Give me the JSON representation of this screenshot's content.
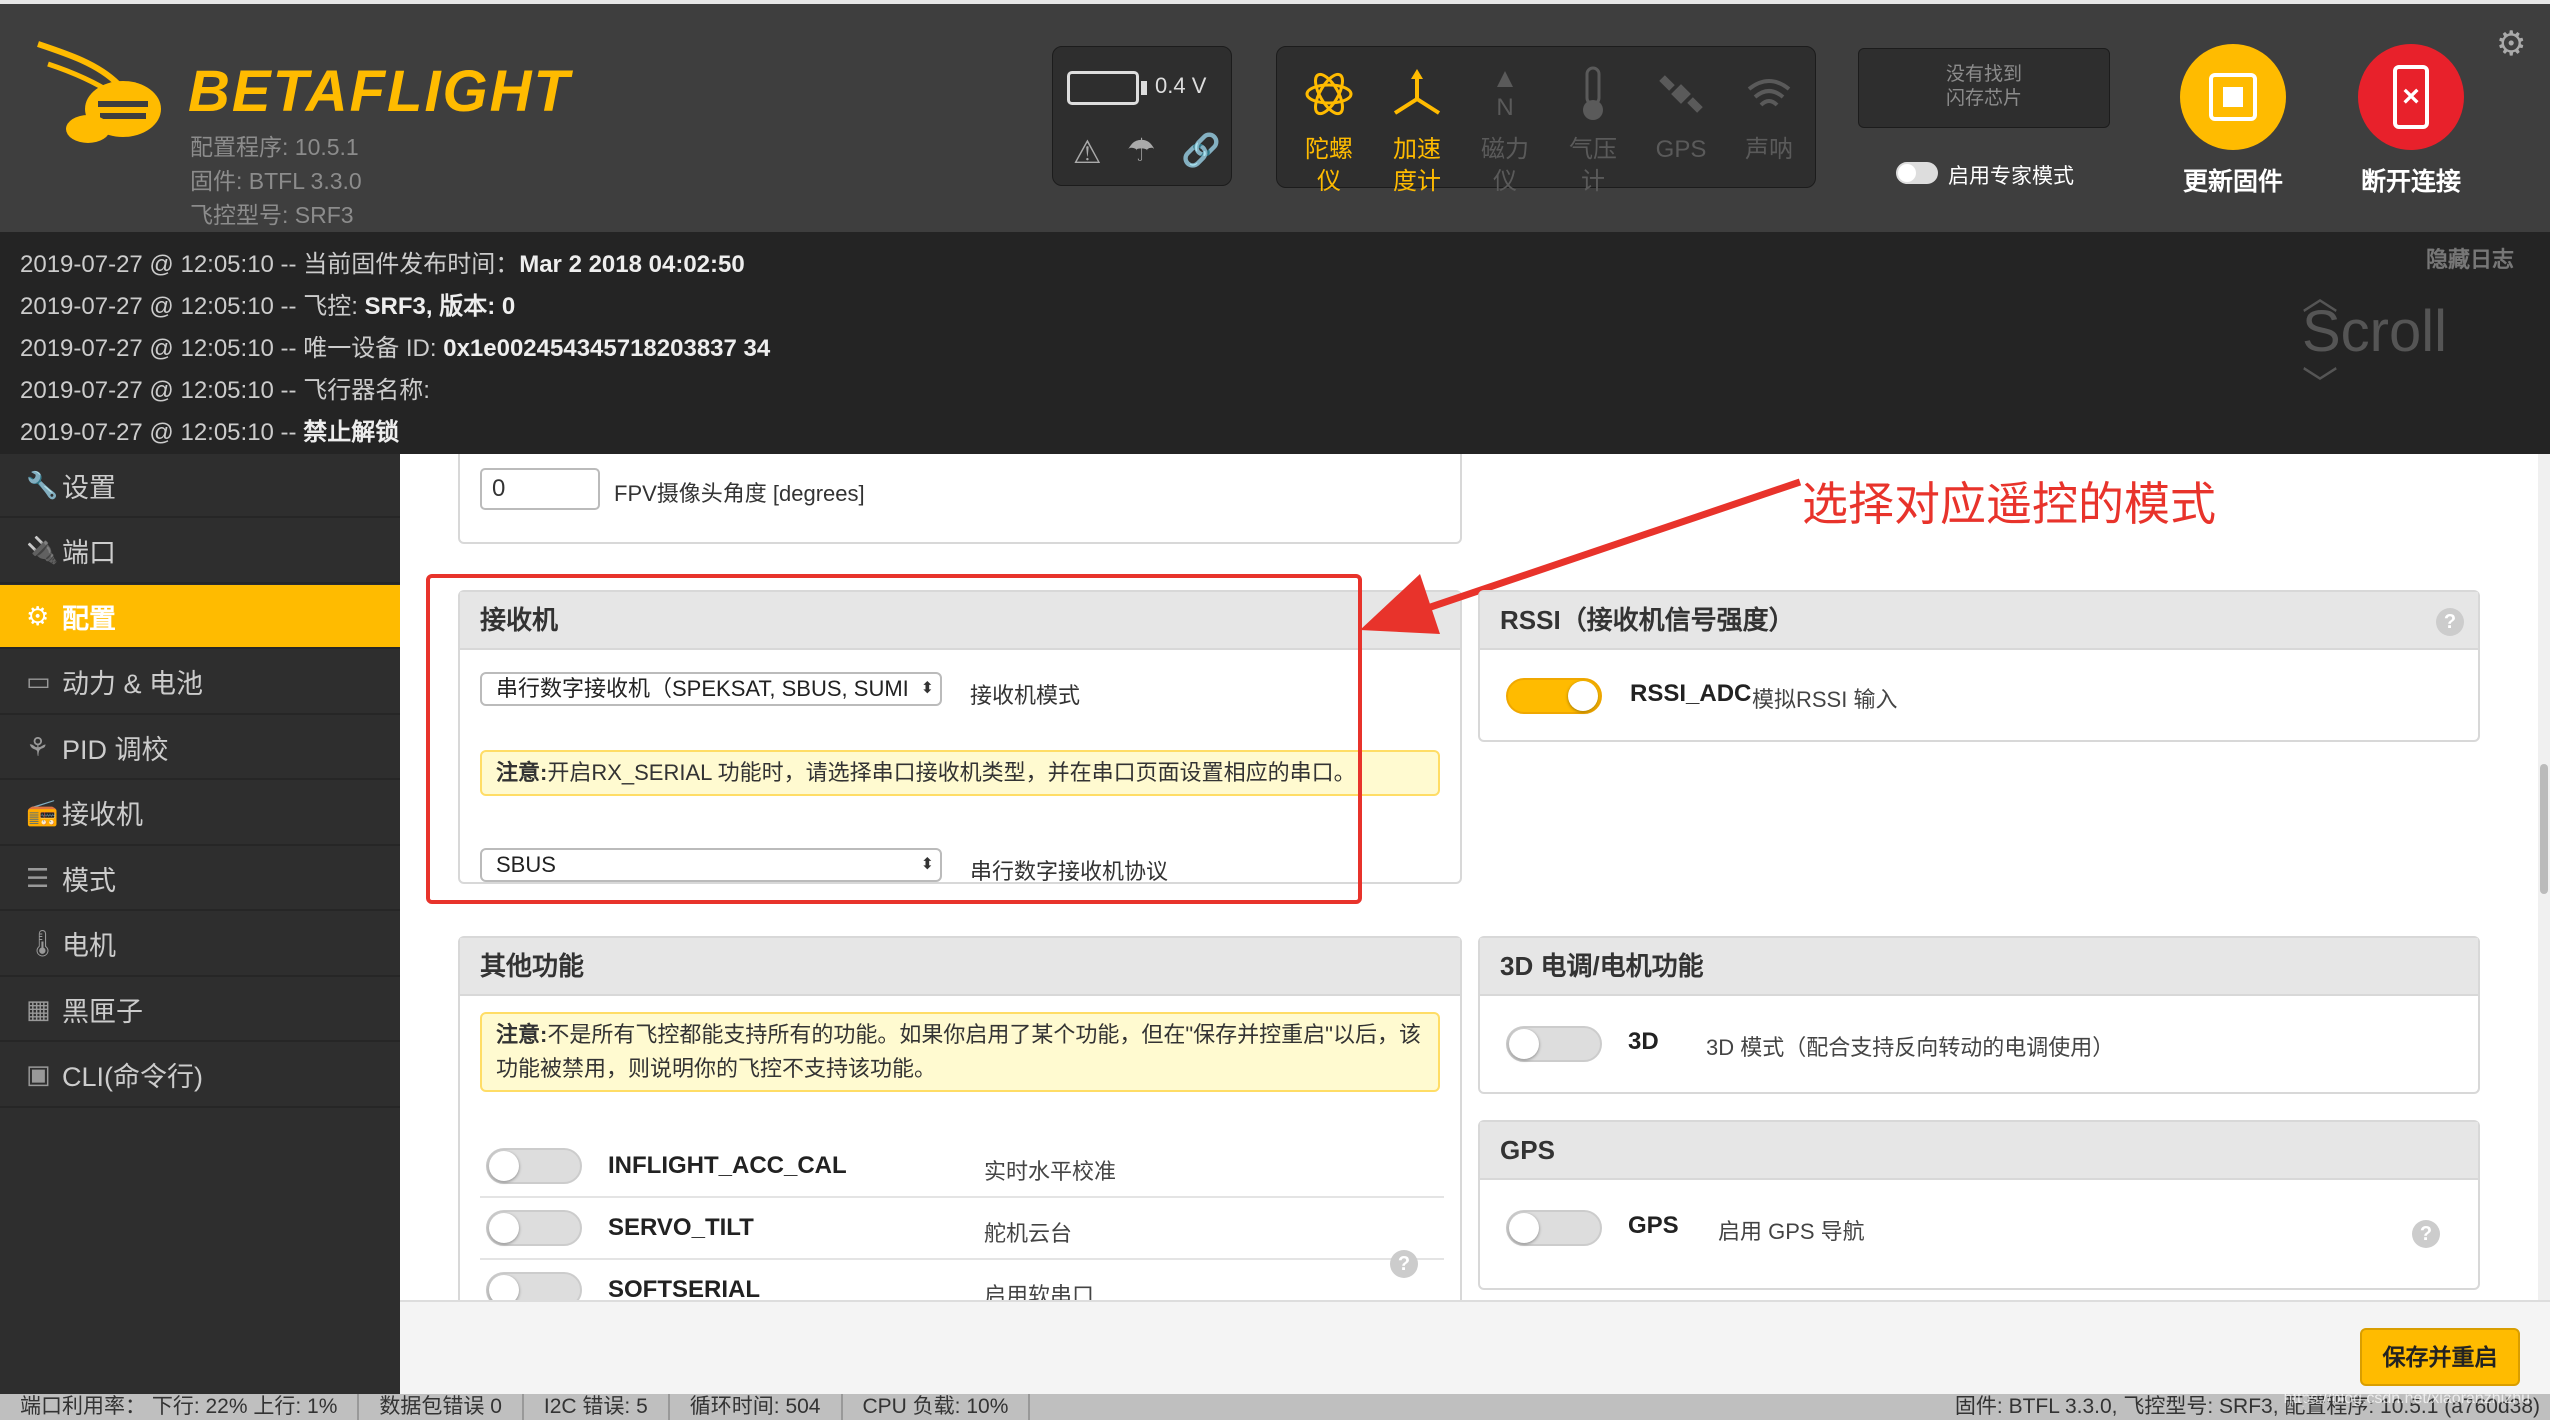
{
  "header": {
    "logo": "BETAFLIGHT",
    "config_version": "配置程序: 10.5.1",
    "firmware": "固件: BTFL 3.3.0",
    "board": "飞控型号: SRF3",
    "battery_voltage": "0.4 V",
    "sensors": [
      {
        "label1": "陀螺",
        "label2": "仪",
        "icon": "gyro-icon",
        "state": "on"
      },
      {
        "label1": "加速",
        "label2": "度计",
        "icon": "accelerometer-icon",
        "state": "on"
      },
      {
        "label1": "磁力",
        "label2": "仪",
        "icon": "magnetometer-icon",
        "state": "off"
      },
      {
        "label1": "气压",
        "label2": "计",
        "icon": "barometer-icon",
        "state": "off"
      },
      {
        "label1": "GPS",
        "label2": "",
        "icon": "gps-icon",
        "state": "off"
      },
      {
        "label1": "声呐",
        "label2": "",
        "icon": "sonar-icon",
        "state": "off"
      }
    ],
    "flash_line1": "没有找到",
    "flash_line2": "闪存芯片",
    "expert_mode": "启用专家模式",
    "update_firmware": "更新固件",
    "disconnect": "断开连接",
    "accent": "#ffbb00",
    "disconnect_color": "#e8212b"
  },
  "log": {
    "hide_label": "隐藏日志",
    "scroll_label": "Scroll",
    "lines": [
      {
        "prefix": "2019-07-27 @ 12:05:10 -- 当前固件发布时间：",
        "value": "Mar 2 2018 04:02:50"
      },
      {
        "prefix": "2019-07-27 @ 12:05:10 -- 飞控: ",
        "value": "SRF3, 版本: 0"
      },
      {
        "prefix": "2019-07-27 @ 12:05:10 -- 唯一设备 ID: ",
        "value": "0x1e002454345718203837 34"
      },
      {
        "prefix": "2019-07-27 @ 12:05:10 -- 飞行器名称:",
        "value": ""
      },
      {
        "prefix": "2019-07-27 @ 12:05:10 -- ",
        "value": "禁止解锁"
      }
    ]
  },
  "sidebar": {
    "items": [
      {
        "label": "设置",
        "icon": "wrench-icon"
      },
      {
        "label": "端口",
        "icon": "plug-icon"
      },
      {
        "label": "配置",
        "icon": "gear-icon",
        "active": true
      },
      {
        "label": "动力 & 电池",
        "icon": "battery-icon"
      },
      {
        "label": "PID 调校",
        "icon": "pid-icon"
      },
      {
        "label": "接收机",
        "icon": "receiver-icon"
      },
      {
        "label": "模式",
        "icon": "modes-icon"
      },
      {
        "label": "电机",
        "icon": "motor-icon"
      },
      {
        "label": "黑匣子",
        "icon": "blackbox-icon"
      },
      {
        "label": "CLI(命令行)",
        "icon": "cli-icon"
      }
    ]
  },
  "main": {
    "fpv": {
      "value": "0",
      "label": "FPV摄像头角度 [degrees]"
    },
    "annotation": "选择对应遥控的模式",
    "receiver": {
      "title": "接收机",
      "mode_value": "串行数字接收机（SPEKSAT, SBUS, SUMI",
      "mode_label": "接收机模式",
      "note_bold": "注意:",
      "note_text": "开启RX_SERIAL 功能时，请选择串口接收机类型，并在串口页面设置相应的串口。",
      "protocol_value": "SBUS",
      "protocol_label": "串行数字接收机协议"
    },
    "rssi": {
      "title": "RSSI（接收机信号强度）",
      "name": "RSSI_ADC",
      "desc": "模拟RSSI 输入"
    },
    "other": {
      "title": "其他功能",
      "note_bold": "注意:",
      "note_text": "不是所有飞控都能支持所有的功能。如果你启用了某个功能，但在\"保存并控重启\"以后，该功能被禁用，则说明你的飞控不支持该功能。",
      "features": [
        {
          "name": "INFLIGHT_ACC_CAL",
          "desc": "实时水平校准"
        },
        {
          "name": "SERVO_TILT",
          "desc": "舵机云台"
        },
        {
          "name": "SOFTSERIAL",
          "desc": "启用软串口"
        }
      ]
    },
    "esc3d": {
      "title": "3D 电调/电机功能",
      "name": "3D",
      "desc": "3D 模式（配合支持反向转动的电调使用）"
    },
    "gps": {
      "title": "GPS",
      "name": "GPS",
      "desc": "启用 GPS 导航"
    }
  },
  "footer": {
    "save": "保存并重启",
    "status": [
      "端口利用率： 下行: 22% 上行: 1%",
      "数据包错误 0",
      "I2C 错误: 5",
      "循环时间: 504",
      "CPU 负载: 10%"
    ],
    "right": "固件: BTFL 3.3.0, 飞控型号: SRF3, 配置程序: 10.5.1 (a760d38)",
    "watermark": "https://blog.csdn.net/xiaoranzhizhu"
  }
}
